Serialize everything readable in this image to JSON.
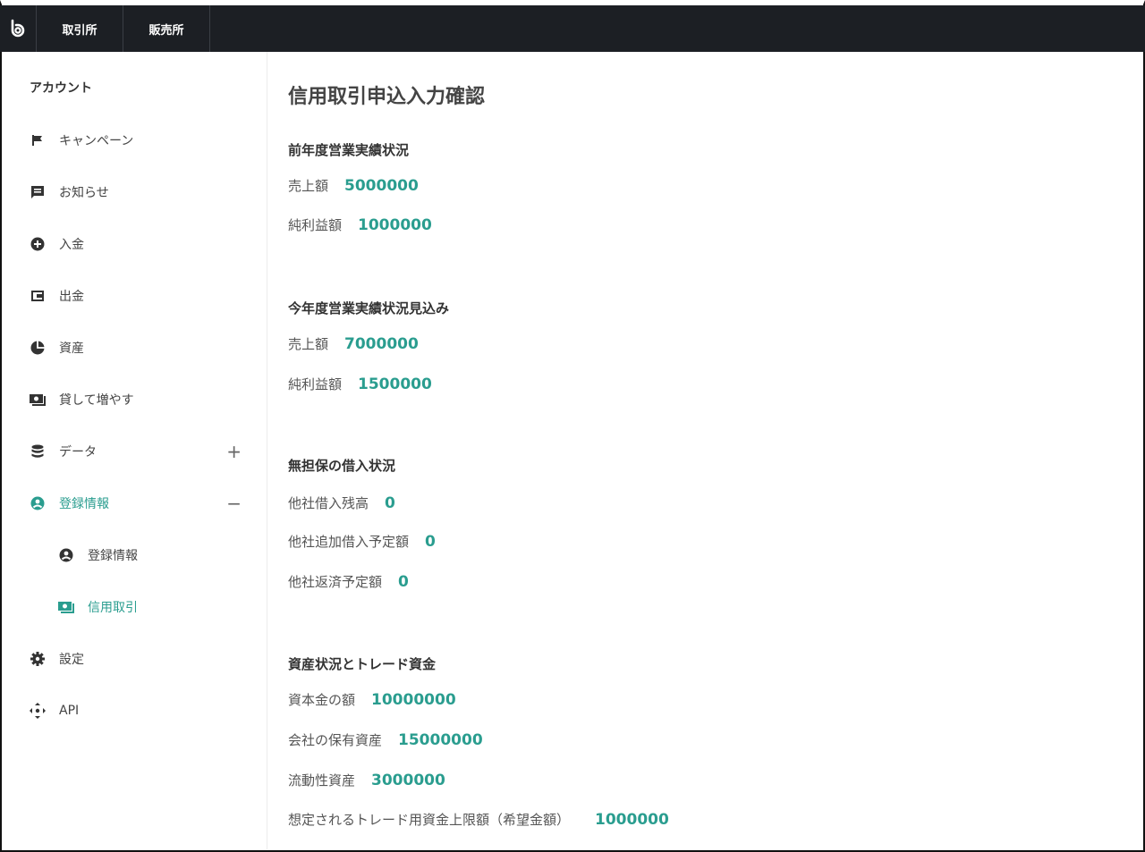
{
  "topbar": {
    "tabs": [
      {
        "label": "取引所"
      },
      {
        "label": "販売所"
      }
    ]
  },
  "sidebar": {
    "heading": "アカウント",
    "items": [
      {
        "label": "キャンペーン",
        "icon": "flag-icon"
      },
      {
        "label": "お知らせ",
        "icon": "message-icon"
      },
      {
        "label": "入金",
        "icon": "plus-circle-icon"
      },
      {
        "label": "出金",
        "icon": "wallet-icon"
      },
      {
        "label": "資産",
        "icon": "pie-chart-icon"
      },
      {
        "label": "貸して増やす",
        "icon": "cash-icon"
      },
      {
        "label": "データ",
        "icon": "database-icon",
        "toggle": "+"
      },
      {
        "label": "登録情報",
        "icon": "user-circle-icon",
        "toggle": "−",
        "active": true
      },
      {
        "label": "登録情報",
        "icon": "user-circle-icon",
        "sub": true
      },
      {
        "label": "信用取引",
        "icon": "cash-icon",
        "sub": true,
        "active": true
      },
      {
        "label": "設定",
        "icon": "gear-icon"
      },
      {
        "label": "API",
        "icon": "api-icon"
      }
    ],
    "accent_color": "#2a9d8f"
  },
  "main": {
    "title": "信用取引申込入力確認",
    "sections": [
      {
        "title": "前年度営業実績状況",
        "rows": [
          {
            "label": "売上額",
            "value": "5000000"
          },
          {
            "label": "純利益額",
            "value": "1000000"
          }
        ]
      },
      {
        "title": "今年度営業実績状況見込み",
        "rows": [
          {
            "label": "売上額",
            "value": "7000000"
          },
          {
            "label": "純利益額",
            "value": "1500000"
          }
        ]
      },
      {
        "title": "無担保の借入状況",
        "rows": [
          {
            "label": "他社借入残高",
            "value": "0"
          },
          {
            "label": "他社追加借入予定額",
            "value": "0"
          },
          {
            "label": "他社返済予定額",
            "value": "0"
          }
        ]
      },
      {
        "title": "資産状況とトレード資金",
        "rows": [
          {
            "label": "資本金の額",
            "value": "10000000"
          },
          {
            "label": "会社の保有資産",
            "value": "15000000"
          },
          {
            "label": "流動性資産",
            "value": "3000000"
          },
          {
            "label": "想定されるトレード用資金上限額（希望金額）",
            "value": "1000000"
          }
        ]
      }
    ]
  }
}
